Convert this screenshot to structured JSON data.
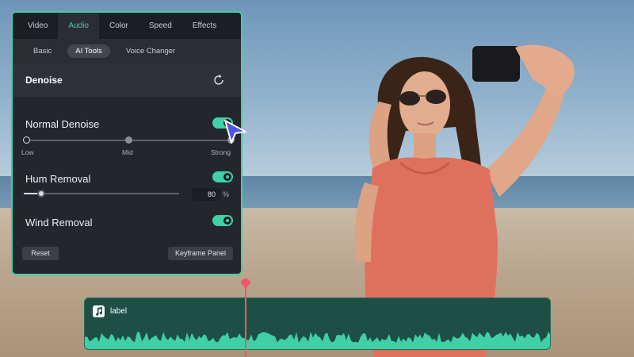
{
  "tabs": [
    {
      "label": "Video"
    },
    {
      "label": "Audio",
      "active": true
    },
    {
      "label": "Color"
    },
    {
      "label": "Speed"
    },
    {
      "label": "Effects"
    }
  ],
  "subtabs": [
    {
      "label": "Basic"
    },
    {
      "label": "AI Tools",
      "active": true
    },
    {
      "label": "Voice Changer"
    }
  ],
  "section": {
    "title": "Denoise"
  },
  "normal_denoise": {
    "label": "Normal Denoise",
    "enabled": true,
    "levels": [
      "Low",
      "Mid",
      "Strong"
    ],
    "selected_level": "Low"
  },
  "hum_removal": {
    "label": "Hum Removal",
    "enabled": true,
    "value": "80",
    "unit": "%"
  },
  "wind_removal": {
    "label": "Wind Removal",
    "enabled": true
  },
  "buttons": {
    "reset": "Reset",
    "keyframe": "Keyframe Panel"
  },
  "timeline": {
    "clip_label": "label"
  },
  "colors": {
    "accent": "#3fd0a5",
    "playhead": "#f0566c",
    "panel": "#23272d"
  }
}
